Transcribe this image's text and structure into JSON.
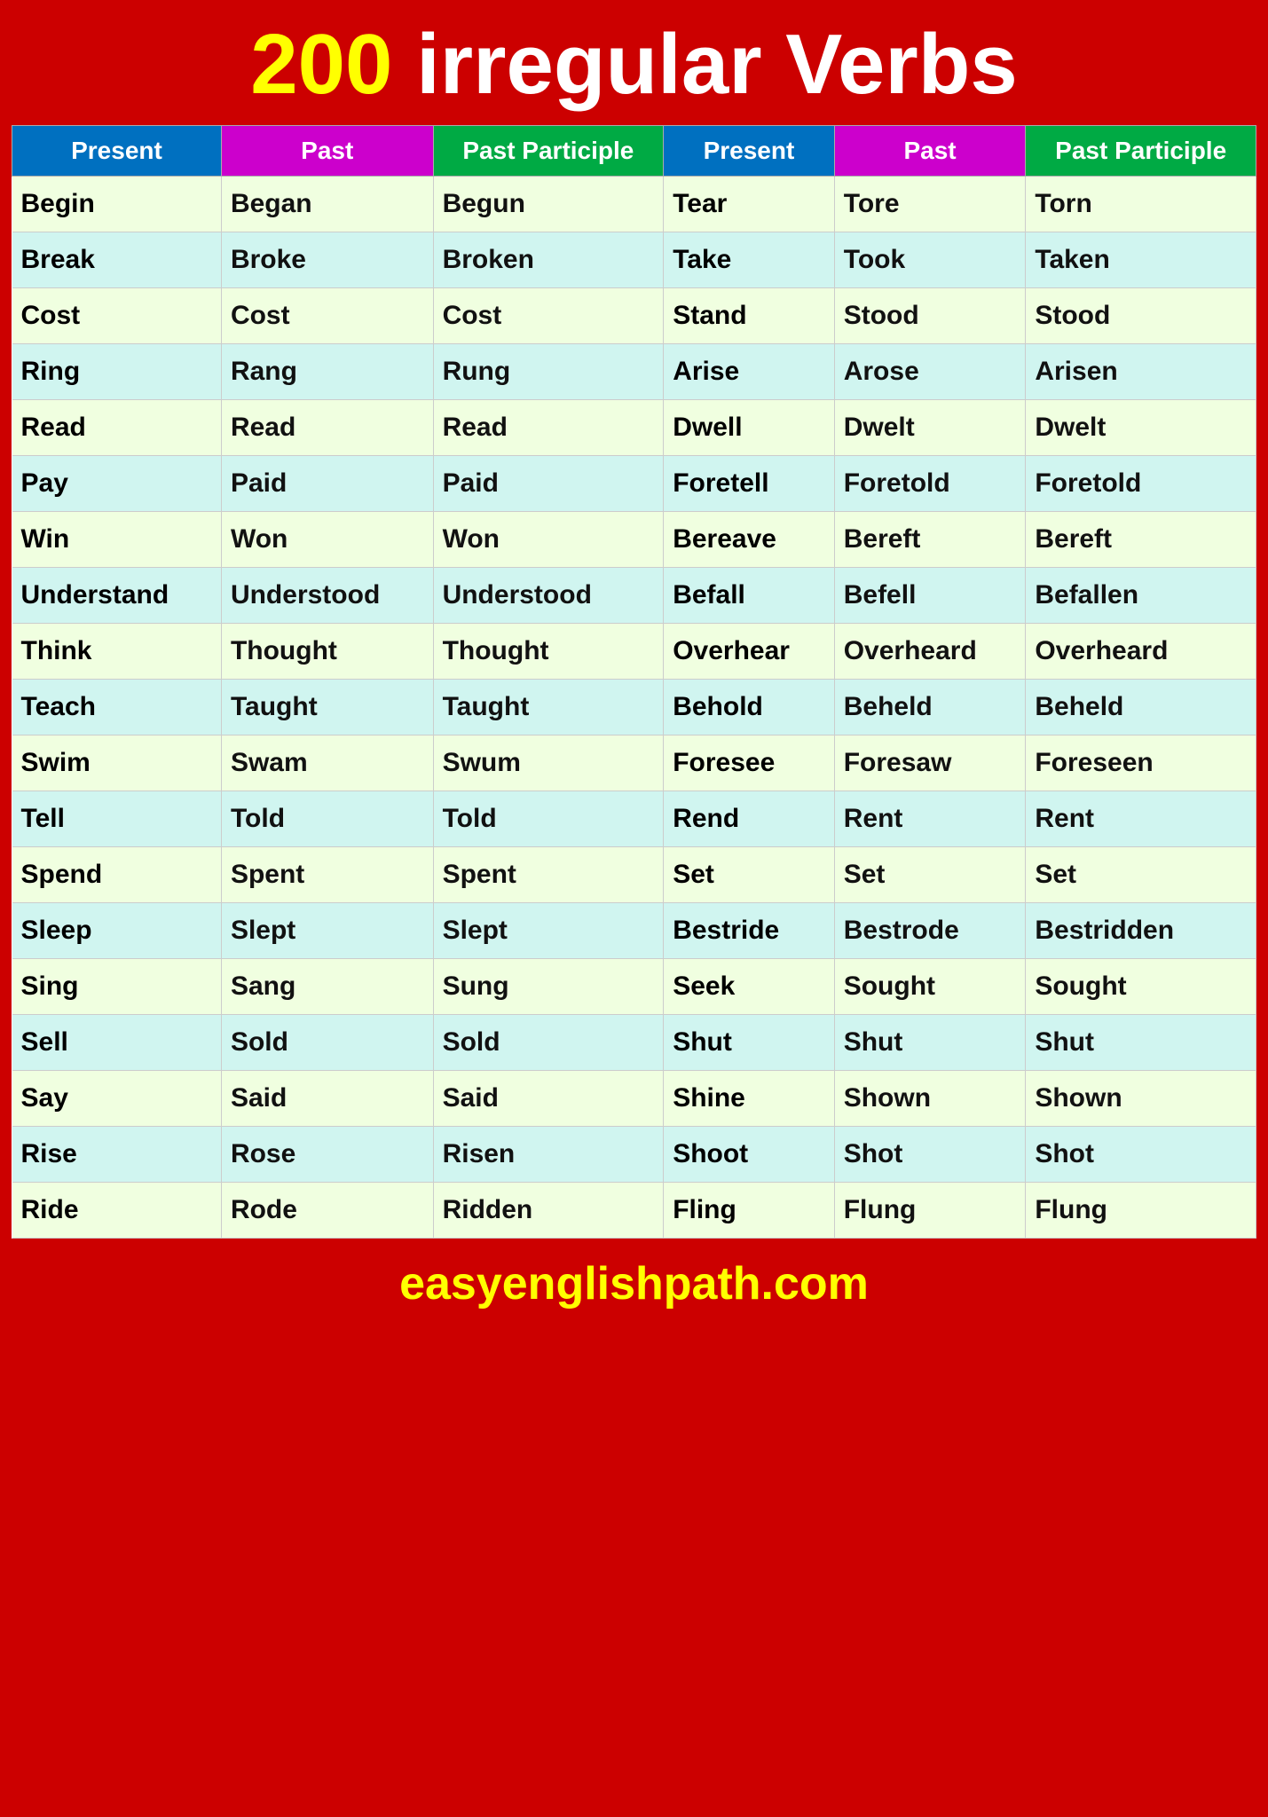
{
  "title": {
    "number": "200",
    "rest": " irregular Verbs"
  },
  "headers": {
    "col1": "Present",
    "col2": "Past",
    "col3": "Past Participle",
    "col4": "Present",
    "col5": "Past",
    "col6": "Past Participle"
  },
  "rows": [
    [
      "Begin",
      "Began",
      "Begun",
      "Tear",
      "Tore",
      "Torn"
    ],
    [
      "Break",
      "Broke",
      "Broken",
      "Take",
      "Took",
      "Taken"
    ],
    [
      "Cost",
      "Cost",
      "Cost",
      "Stand",
      "Stood",
      "Stood"
    ],
    [
      "Ring",
      "Rang",
      "Rung",
      "Arise",
      "Arose",
      "Arisen"
    ],
    [
      "Read",
      "Read",
      "Read",
      "Dwell",
      "Dwelt",
      "Dwelt"
    ],
    [
      "Pay",
      "Paid",
      "Paid",
      "Foretell",
      "Foretold",
      "Foretold"
    ],
    [
      "Win",
      "Won",
      "Won",
      "Bereave",
      "Bereft",
      "Bereft"
    ],
    [
      "Understand",
      "Understood",
      "Understood",
      "Befall",
      "Befell",
      "Befallen"
    ],
    [
      "Think",
      "Thought",
      "Thought",
      "Overhear",
      "Overheard",
      "Overheard"
    ],
    [
      "Teach",
      "Taught",
      "Taught",
      "Behold",
      "Beheld",
      "Beheld"
    ],
    [
      "Swim",
      "Swam",
      "Swum",
      "Foresee",
      "Foresaw",
      "Foreseen"
    ],
    [
      "Tell",
      "Told",
      "Told",
      "Rend",
      "Rent",
      "Rent"
    ],
    [
      "Spend",
      "Spent",
      "Spent",
      "Set",
      "Set",
      "Set"
    ],
    [
      "Sleep",
      "Slept",
      "Slept",
      "Bestride",
      "Bestrode",
      "Bestridden"
    ],
    [
      "Sing",
      "Sang",
      "Sung",
      "Seek",
      "Sought",
      "Sought"
    ],
    [
      "Sell",
      "Sold",
      "Sold",
      "Shut",
      "Shut",
      "Shut"
    ],
    [
      "Say",
      "Said",
      "Said",
      "Shine",
      "Shown",
      "Shown"
    ],
    [
      "Rise",
      "Rose",
      "Risen",
      "Shoot",
      "Shot",
      "Shot"
    ],
    [
      "Ride",
      "Rode",
      "Ridden",
      "Fling",
      "Flung",
      "Flung"
    ]
  ],
  "footer": {
    "text": "easyenglishpath.com"
  }
}
